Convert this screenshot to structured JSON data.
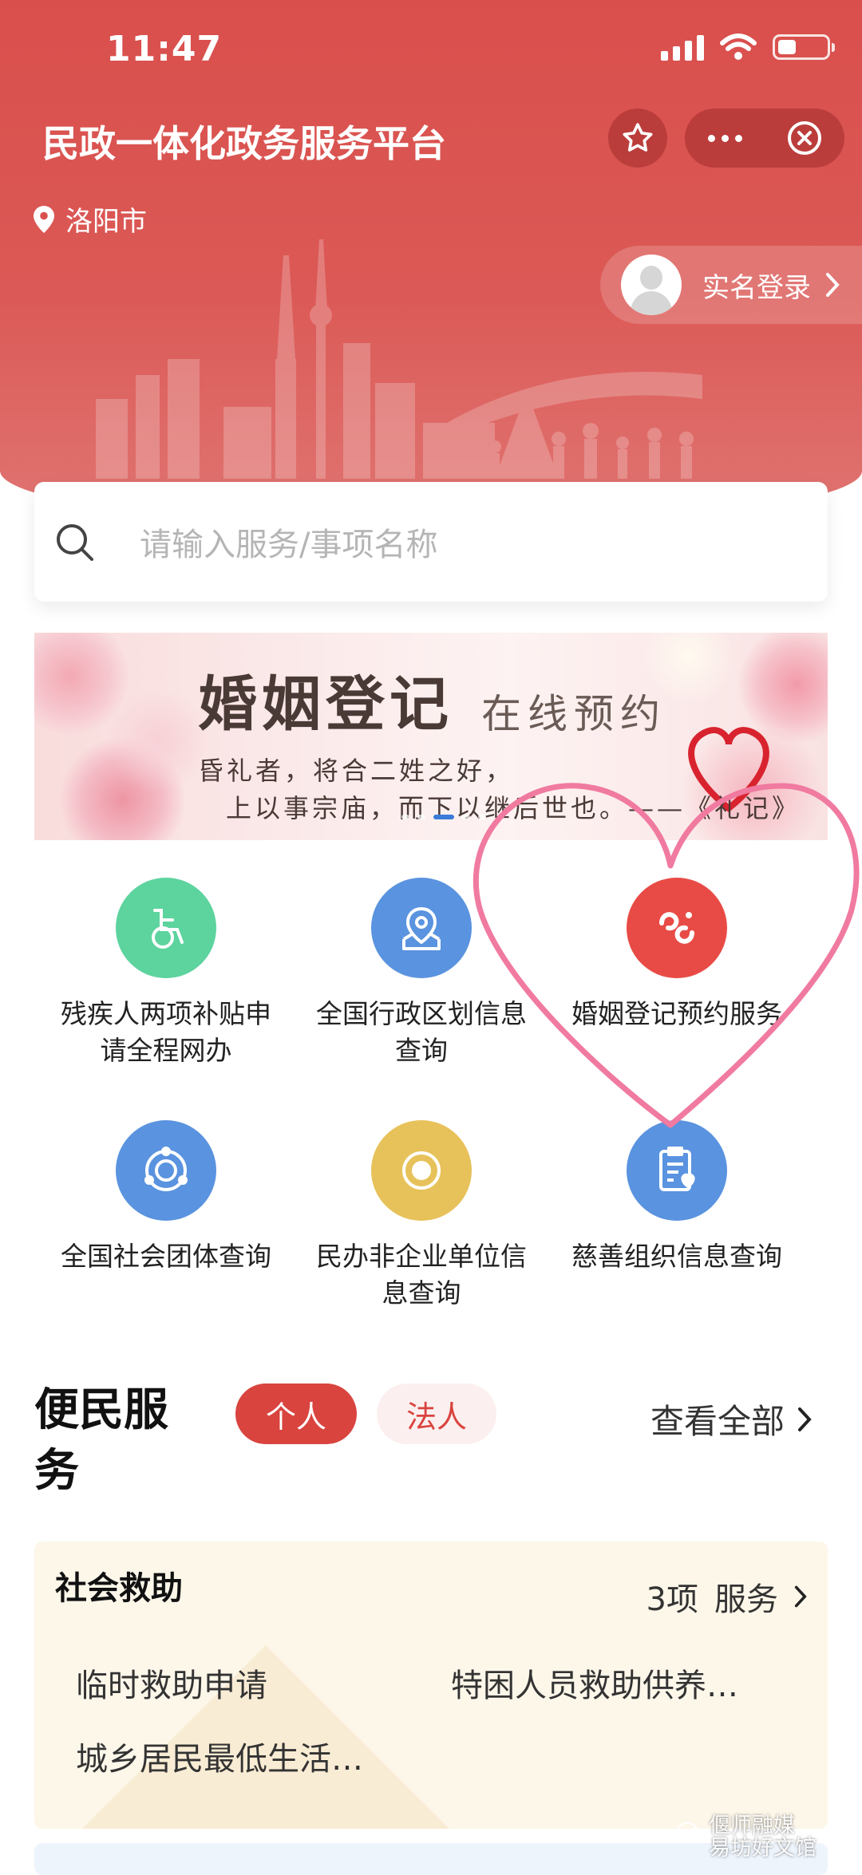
{
  "status_bar": {
    "time": "11:47"
  },
  "header": {
    "title": "民政一体化政务服务平台"
  },
  "location": {
    "city": "洛阳市"
  },
  "login": {
    "label": "实名登录"
  },
  "search": {
    "placeholder": "请输入服务/事项名称"
  },
  "banner": {
    "title": "婚姻登记",
    "subtitle": "在线预约",
    "line1": "昏礼者，将合二姓之好，",
    "line2": "上以事宗庙，而下以继后世也。——《礼记》",
    "active_slide": 2
  },
  "services": [
    {
      "label": "残疾人两项补贴申请全程网办",
      "icon": "wheelchair-icon",
      "color": "#5dd39e"
    },
    {
      "label": "全国行政区划信息查询",
      "icon": "map-pin-icon",
      "color": "#5a93df"
    },
    {
      "label": "婚姻登记预约服务",
      "icon": "marriage-logo-icon",
      "color": "#e84b45"
    },
    {
      "label": "全国社会团体查询",
      "icon": "orbit-icon",
      "color": "#5a93df"
    },
    {
      "label": "民办非企业单位信息查询",
      "icon": "circle-dot-icon",
      "color": "#e7c25a"
    },
    {
      "label": "慈善组织信息查询",
      "icon": "document-heart-icon",
      "color": "#5a93df"
    }
  ],
  "section": {
    "title": "便民服务",
    "tabs": [
      "个人",
      "法人"
    ],
    "active_tab": "个人",
    "view_all": "查看全部"
  },
  "card": {
    "title": "社会救助",
    "count": "3项",
    "count_label": "服务",
    "items": [
      "临时救助申请",
      "特困人员救助供养…",
      "城乡居民最低生活…"
    ]
  },
  "watermark": {
    "line1": "偃师融媒",
    "line2": "易坊好文馆"
  },
  "colors": {
    "primary": "#d9443f",
    "header_bg": "#d94f4c",
    "card_bg": "#fdf7ea",
    "heart_stroke": "#f07aa0"
  }
}
